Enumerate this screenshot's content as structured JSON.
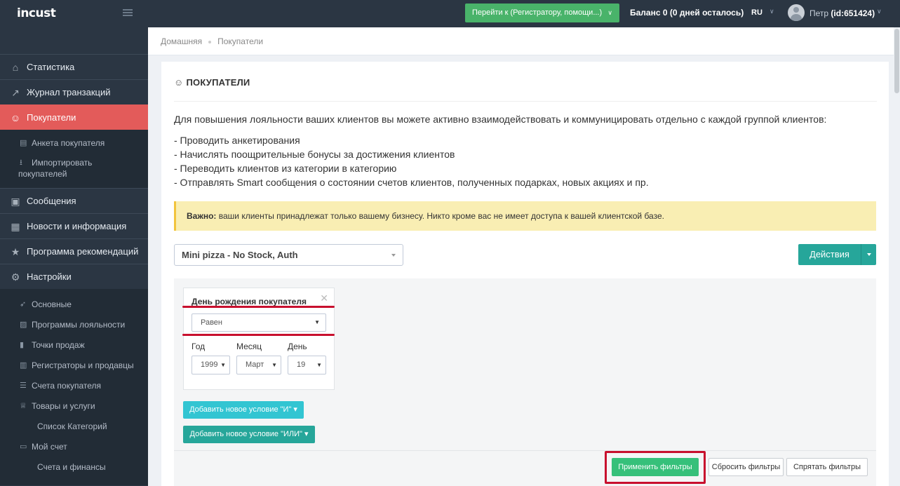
{
  "topbar": {
    "logo": "incust",
    "goto_label": "Перейти к (Регистратору, помощи...)",
    "balance_prefix": "Баланс ",
    "balance_value": "0",
    "balance_suffix": " (0 дней осталось)",
    "lang": "RU",
    "user_name": "Петр ",
    "user_id": "(id:651424)"
  },
  "sidebar": {
    "items": [
      {
        "label": "Статистика",
        "icon": "home-icon"
      },
      {
        "label": "Журнал транзакций",
        "icon": "chart-line-icon"
      },
      {
        "label": "Покупатели",
        "icon": "users-icon",
        "active": true
      },
      {
        "label": "Анкета покупателя",
        "icon": "file-icon"
      },
      {
        "label": "Импортировать",
        "label2": "покупателей",
        "icon": "download-icon"
      },
      {
        "label": "Сообщения",
        "icon": "messages-icon"
      },
      {
        "label": "Новости и информация",
        "icon": "newspaper-icon"
      },
      {
        "label": "Программа рекомендаций",
        "icon": "star-icon"
      },
      {
        "label": "Настройки",
        "icon": "gear-icon"
      },
      {
        "label": "Основные",
        "icon": "rocket-icon"
      },
      {
        "label": "Программы лояльности",
        "icon": "gift-icon"
      },
      {
        "label": "Точки продаж",
        "icon": "book-icon"
      },
      {
        "label": "Регистраторы и продавцы",
        "icon": "cart-icon"
      },
      {
        "label": "Счета покупателя",
        "icon": "list-icon"
      },
      {
        "label": "Товары и услуги",
        "icon": "trophy-icon"
      },
      {
        "label": "Список Категорий"
      },
      {
        "label": "Мой счет",
        "icon": "card-icon"
      },
      {
        "label": "Счета и финансы"
      }
    ]
  },
  "breadcrumb": {
    "home": "Домашняя",
    "current": "Покупатели"
  },
  "page": {
    "title": "ПОКУПАТЕЛИ",
    "intro": "Для повышения лояльности ваших клиентов вы можете активно взаимодействовать и коммуницировать отдельно с каждой группой клиентов:",
    "bullets": [
      "- Проводить анкетирования",
      "- Начислять поощрительные бонусы за достижения клиентов",
      "- Переводить клиентов из категории в категорию",
      "- Отправлять Smart сообщения о состоянии счетов клиентов, полученных подарках, новых акциях и пр."
    ],
    "notice_bold": "Важно:",
    "notice_text": " ваши клиенты принадлежат только вашему бизнесу. Никто кроме вас не имеет доступа к вашей клиентской базе.",
    "business_select": "Mini pizza - No Stock, Auth",
    "actions_label": "Действия"
  },
  "filter": {
    "condition_title": "День рождения покупателя",
    "operator": "Равен",
    "year_label": "Год",
    "month_label": "Месяц",
    "day_label": "День",
    "year_value": "1999",
    "month_value": "Март",
    "day_value": "19",
    "add_and": "Добавить новое условие \"И\" ▾",
    "add_or": "Добавить новое условие \"ИЛИ\" ▾",
    "apply": "Применить фильтры",
    "reset": "Сбросить фильтры",
    "hide": "Спрятать фильтры"
  }
}
